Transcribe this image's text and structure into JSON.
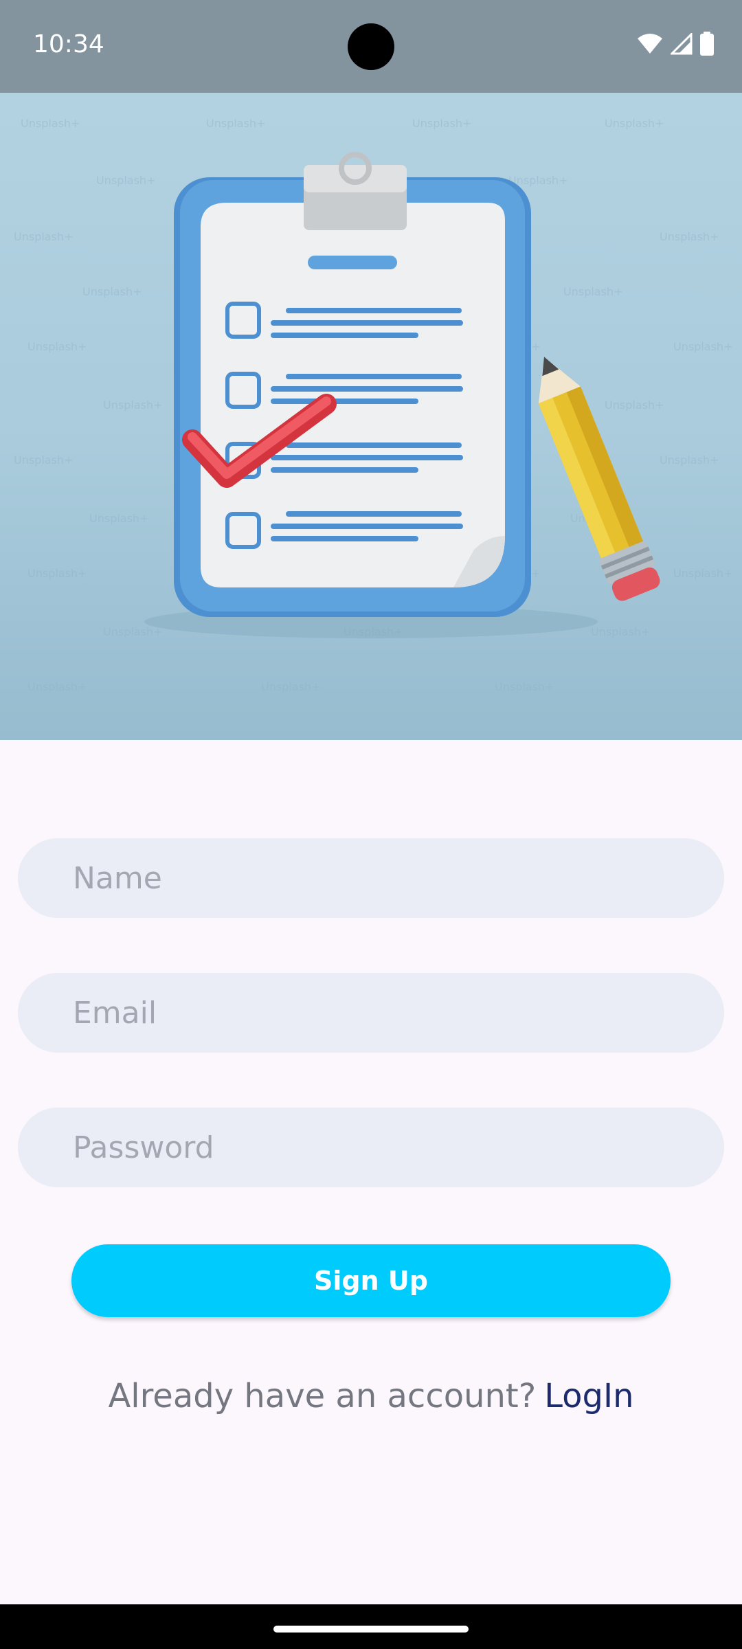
{
  "status_bar": {
    "time": "10:34",
    "icons": [
      "wifi-icon",
      "signal-icon",
      "battery-icon"
    ]
  },
  "hero": {
    "watermark": "Unsplash+",
    "illustration": "clipboard-checklist-with-pencil"
  },
  "form": {
    "name_placeholder": "Name",
    "email_placeholder": "Email",
    "password_placeholder": "Password",
    "name_value": "",
    "email_value": "",
    "password_value": "",
    "signup_label": "Sign Up"
  },
  "login": {
    "prompt": "Already have an account?",
    "link": "LogIn"
  },
  "colors": {
    "background": "#fcf6fd",
    "field": "#eaedf6",
    "accent": "#00cbfd",
    "link": "#1b2b6c"
  }
}
